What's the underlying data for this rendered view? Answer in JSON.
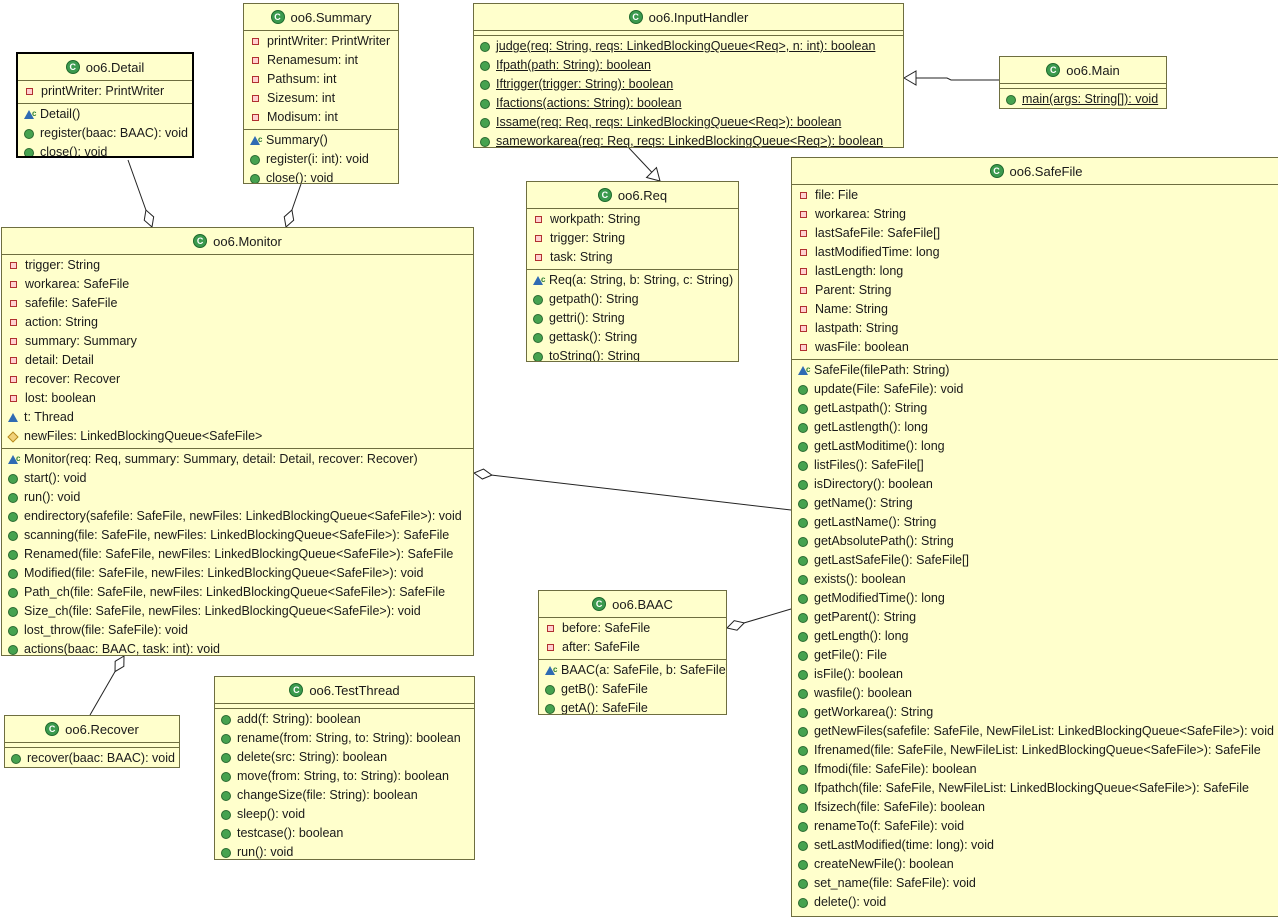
{
  "classes": {
    "detail": {
      "name": "oo6.Detail",
      "fields": [
        {
          "v": "private",
          "t": "printWriter: PrintWriter"
        }
      ],
      "methods": [
        {
          "v": "ctor",
          "t": "Detail()"
        },
        {
          "v": "public",
          "t": "register(baac: BAAC): void"
        },
        {
          "v": "public",
          "t": "close(): void"
        }
      ]
    },
    "summary": {
      "name": "oo6.Summary",
      "fields": [
        {
          "v": "private",
          "t": "printWriter: PrintWriter"
        },
        {
          "v": "private",
          "t": "Renamesum: int"
        },
        {
          "v": "private",
          "t": "Pathsum: int"
        },
        {
          "v": "private",
          "t": "Sizesum: int"
        },
        {
          "v": "private",
          "t": "Modisum: int"
        }
      ],
      "methods": [
        {
          "v": "ctor",
          "t": "Summary()"
        },
        {
          "v": "public",
          "t": "register(i: int): void"
        },
        {
          "v": "public",
          "t": "close(): void"
        }
      ]
    },
    "inputhandler": {
      "name": "oo6.InputHandler",
      "fields": [],
      "methods": [
        {
          "v": "public",
          "t": "judge(req: String, reqs: LinkedBlockingQueue<Req>, n: int): boolean",
          "s": true
        },
        {
          "v": "public",
          "t": "Ifpath(path: String): boolean",
          "s": true
        },
        {
          "v": "public",
          "t": "Iftrigger(trigger: String): boolean",
          "s": true
        },
        {
          "v": "public",
          "t": "Ifactions(actions: String): boolean",
          "s": true
        },
        {
          "v": "public",
          "t": "Issame(req: Req, reqs: LinkedBlockingQueue<Req>): boolean",
          "s": true
        },
        {
          "v": "public",
          "t": "sameworkarea(req: Req, reqs: LinkedBlockingQueue<Req>): boolean",
          "s": true
        }
      ]
    },
    "main": {
      "name": "oo6.Main",
      "fields": [],
      "methods": [
        {
          "v": "public",
          "t": "main(args: String[]): void",
          "s": true
        }
      ]
    },
    "req": {
      "name": "oo6.Req",
      "fields": [
        {
          "v": "private",
          "t": "workpath: String"
        },
        {
          "v": "private",
          "t": "trigger: String"
        },
        {
          "v": "private",
          "t": "task: String"
        }
      ],
      "methods": [
        {
          "v": "ctor",
          "t": "Req(a: String, b: String, c: String)"
        },
        {
          "v": "public",
          "t": "getpath(): String"
        },
        {
          "v": "public",
          "t": "gettri(): String"
        },
        {
          "v": "public",
          "t": "gettask(): String"
        },
        {
          "v": "public",
          "t": "toString(): String"
        }
      ]
    },
    "monitor": {
      "name": "oo6.Monitor",
      "fields": [
        {
          "v": "private",
          "t": "trigger: String"
        },
        {
          "v": "private",
          "t": "workarea: SafeFile"
        },
        {
          "v": "private",
          "t": "safefile: SafeFile"
        },
        {
          "v": "private",
          "t": "action: String"
        },
        {
          "v": "private",
          "t": "summary: Summary"
        },
        {
          "v": "private",
          "t": "detail: Detail"
        },
        {
          "v": "private",
          "t": "recover: Recover"
        },
        {
          "v": "private",
          "t": "lost: boolean"
        },
        {
          "v": "package",
          "t": "t: Thread"
        },
        {
          "v": "protected",
          "t": "newFiles: LinkedBlockingQueue<SafeFile>"
        }
      ],
      "methods": [
        {
          "v": "ctor",
          "t": "Monitor(req: Req, summary: Summary, detail: Detail, recover: Recover)"
        },
        {
          "v": "public",
          "t": "start(): void"
        },
        {
          "v": "public",
          "t": "run(): void"
        },
        {
          "v": "public",
          "t": "endirectory(safefile: SafeFile, newFiles: LinkedBlockingQueue<SafeFile>): void"
        },
        {
          "v": "public",
          "t": "scanning(file: SafeFile, newFiles: LinkedBlockingQueue<SafeFile>): SafeFile"
        },
        {
          "v": "public",
          "t": "Renamed(file: SafeFile, newFiles: LinkedBlockingQueue<SafeFile>): SafeFile"
        },
        {
          "v": "public",
          "t": "Modified(file: SafeFile, newFiles: LinkedBlockingQueue<SafeFile>): void"
        },
        {
          "v": "public",
          "t": "Path_ch(file: SafeFile, newFiles: LinkedBlockingQueue<SafeFile>): SafeFile"
        },
        {
          "v": "public",
          "t": "Size_ch(file: SafeFile, newFiles: LinkedBlockingQueue<SafeFile>): void"
        },
        {
          "v": "public",
          "t": "lost_throw(file: SafeFile): void"
        },
        {
          "v": "public",
          "t": "actions(baac: BAAC, task: int): void"
        }
      ]
    },
    "safefile": {
      "name": "oo6.SafeFile",
      "fields": [
        {
          "v": "private",
          "t": "file: File"
        },
        {
          "v": "private",
          "t": "workarea: String"
        },
        {
          "v": "private",
          "t": "lastSafeFile: SafeFile[]"
        },
        {
          "v": "private",
          "t": "lastModifiedTime: long"
        },
        {
          "v": "private",
          "t": "lastLength: long"
        },
        {
          "v": "private",
          "t": "Parent: String"
        },
        {
          "v": "private",
          "t": "Name: String"
        },
        {
          "v": "private",
          "t": "lastpath: String"
        },
        {
          "v": "private",
          "t": "wasFile: boolean"
        }
      ],
      "methods": [
        {
          "v": "ctor",
          "t": "SafeFile(filePath: String)"
        },
        {
          "v": "public",
          "t": "update(File: SafeFile): void"
        },
        {
          "v": "public",
          "t": "getLastpath(): String"
        },
        {
          "v": "public",
          "t": "getLastlength(): long"
        },
        {
          "v": "public",
          "t": "getLastModitime(): long"
        },
        {
          "v": "public",
          "t": "listFiles(): SafeFile[]"
        },
        {
          "v": "public",
          "t": "isDirectory(): boolean"
        },
        {
          "v": "public",
          "t": "getName(): String"
        },
        {
          "v": "public",
          "t": "getLastName(): String"
        },
        {
          "v": "public",
          "t": "getAbsolutePath(): String"
        },
        {
          "v": "public",
          "t": "getLastSafeFile(): SafeFile[]"
        },
        {
          "v": "public",
          "t": "exists(): boolean"
        },
        {
          "v": "public",
          "t": "getModifiedTime(): long"
        },
        {
          "v": "public",
          "t": "getParent(): String"
        },
        {
          "v": "public",
          "t": "getLength(): long"
        },
        {
          "v": "public",
          "t": "getFile(): File"
        },
        {
          "v": "public",
          "t": "isFile(): boolean"
        },
        {
          "v": "public",
          "t": "wasfile(): boolean"
        },
        {
          "v": "public",
          "t": "getWorkarea(): String"
        },
        {
          "v": "public",
          "t": "getNewFiles(safefile: SafeFile, NewFileList: LinkedBlockingQueue<SafeFile>): void"
        },
        {
          "v": "public",
          "t": "Ifrenamed(file: SafeFile, NewFileList: LinkedBlockingQueue<SafeFile>): SafeFile"
        },
        {
          "v": "public",
          "t": "Ifmodi(file: SafeFile): boolean"
        },
        {
          "v": "public",
          "t": "Ifpathch(file: SafeFile, NewFileList: LinkedBlockingQueue<SafeFile>): SafeFile"
        },
        {
          "v": "public",
          "t": "Ifsizech(file: SafeFile): boolean"
        },
        {
          "v": "public",
          "t": "renameTo(f: SafeFile): void"
        },
        {
          "v": "public",
          "t": "setLastModified(time: long): void"
        },
        {
          "v": "public",
          "t": "createNewFile(): boolean"
        },
        {
          "v": "public",
          "t": "set_name(file: SafeFile): void"
        },
        {
          "v": "public",
          "t": "delete(): void"
        }
      ]
    },
    "baac": {
      "name": "oo6.BAAC",
      "fields": [
        {
          "v": "private",
          "t": "before: SafeFile"
        },
        {
          "v": "private",
          "t": "after: SafeFile"
        }
      ],
      "methods": [
        {
          "v": "ctor",
          "t": "BAAC(a: SafeFile, b: SafeFile)"
        },
        {
          "v": "public",
          "t": "getB(): SafeFile"
        },
        {
          "v": "public",
          "t": "getA(): SafeFile"
        }
      ]
    },
    "recover": {
      "name": "oo6.Recover",
      "fields": [],
      "methods": [
        {
          "v": "public",
          "t": "recover(baac: BAAC): void"
        }
      ]
    },
    "testthread": {
      "name": "oo6.TestThread",
      "fields": [],
      "methods": [
        {
          "v": "public",
          "t": "add(f: String): boolean"
        },
        {
          "v": "public",
          "t": "rename(from: String, to: String): boolean"
        },
        {
          "v": "public",
          "t": "delete(src: String): boolean"
        },
        {
          "v": "public",
          "t": "move(from: String, to: String): boolean"
        },
        {
          "v": "public",
          "t": "changeSize(file: String): boolean"
        },
        {
          "v": "public",
          "t": "sleep(): void"
        },
        {
          "v": "public",
          "t": "testcase(): boolean"
        },
        {
          "v": "public",
          "t": "run(): void"
        }
      ]
    }
  },
  "relations": [
    {
      "kind": "aggregation",
      "from": "monitor",
      "to": "detail"
    },
    {
      "kind": "aggregation",
      "from": "monitor",
      "to": "summary"
    },
    {
      "kind": "aggregation",
      "from": "monitor",
      "to": "recover"
    },
    {
      "kind": "aggregation",
      "from": "monitor",
      "to": "safefile"
    },
    {
      "kind": "aggregation",
      "from": "baac",
      "to": "safefile"
    },
    {
      "kind": "generalization",
      "from": "main",
      "to": "inputhandler"
    },
    {
      "kind": "generalization",
      "from": "inputhandler",
      "to": "req"
    }
  ]
}
